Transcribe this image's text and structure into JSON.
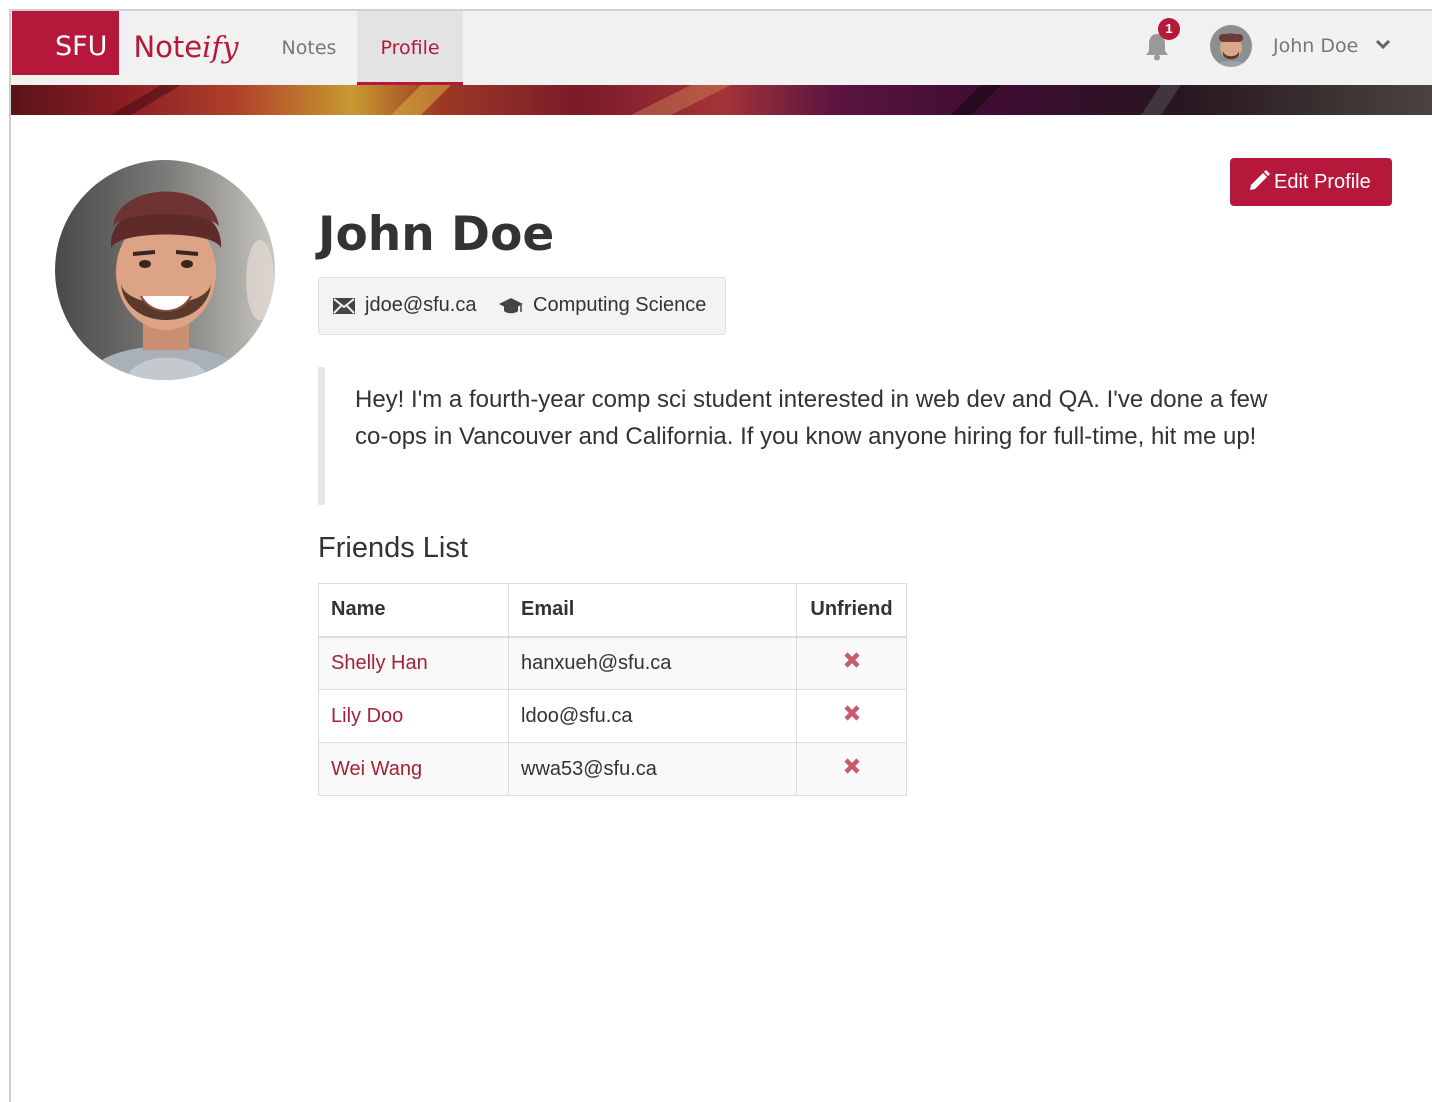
{
  "brand": {
    "sfu": "SFU",
    "name_prefix": "Note",
    "name_script": "ify",
    "color": "#b5183a"
  },
  "nav": {
    "items": [
      {
        "label": "Notes",
        "active": false
      },
      {
        "label": "Profile",
        "active": true
      }
    ],
    "notification_count": "1",
    "user_name": "John Doe",
    "icons": [
      "bell-icon",
      "avatar",
      "chevron-down-icon"
    ]
  },
  "profile": {
    "name": "John Doe",
    "email": "jdoe@sfu.ca",
    "department": "Computing Science",
    "bio": "Hey! I'm a fourth-year comp sci student interested in web dev and QA. I've done a few co-ops in Vancouver and California. If you know anyone hiring for full-time, hit me up!",
    "edit_label": "Edit Profile"
  },
  "friends": {
    "title": "Friends List",
    "columns": [
      "Name",
      "Email",
      "Unfriend"
    ],
    "rows": [
      {
        "name": "Shelly Han",
        "email": "hanxueh@sfu.ca"
      },
      {
        "name": "Lily Doo",
        "email": "ldoo@sfu.ca"
      },
      {
        "name": "Wei Wang",
        "email": "wwa53@sfu.ca"
      }
    ],
    "unfriend_icon": "x-icon",
    "unfriend_color": "#c75b6e"
  }
}
